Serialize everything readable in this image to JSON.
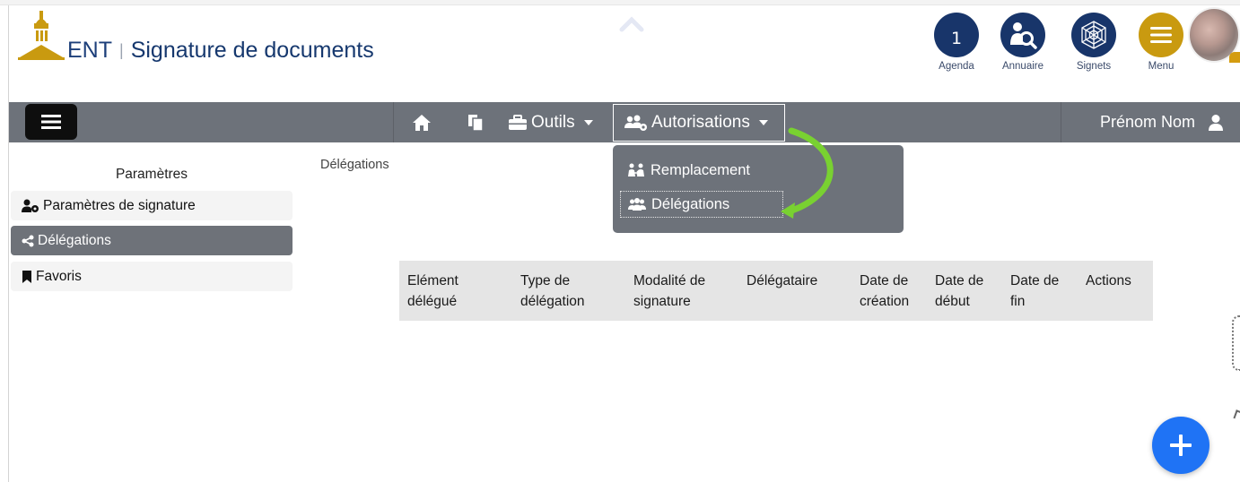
{
  "header": {
    "brand": "ENT",
    "separator": "|",
    "app_title": "Signature de documents",
    "shortcuts": [
      {
        "label": "Agenda",
        "icon": "calendar-icon",
        "value": "1"
      },
      {
        "label": "Annuaire",
        "icon": "directory-search-icon"
      },
      {
        "label": "Signets",
        "icon": "spiderweb-icon"
      },
      {
        "label": "Menu",
        "icon": "menu-icon"
      }
    ],
    "colors": {
      "brand_blue": "#18356a",
      "brand_gold": "#c99a10"
    }
  },
  "navbar": {
    "outils_label": "Outils",
    "autorisations_label": "Autorisations",
    "user_label": "Prénom Nom",
    "background": "#6d727a"
  },
  "dropdown": {
    "items": [
      {
        "label": "Remplacement",
        "icon": "replacement-icon"
      },
      {
        "label": "Délégations",
        "icon": "users-icon"
      }
    ]
  },
  "sidebar": {
    "title": "Paramètres",
    "items": [
      {
        "label": "Paramètres de signature",
        "icon": "user-gear-icon",
        "active": false
      },
      {
        "label": "Délégations",
        "icon": "share-icon",
        "active": true
      },
      {
        "label": "Favoris",
        "icon": "bookmark-icon",
        "active": false
      }
    ]
  },
  "main": {
    "breadcrumb": "Délégations",
    "table": {
      "columns": [
        {
          "line1": "Elément",
          "line2": "délégué"
        },
        {
          "line1": "Type de",
          "line2": "délégation"
        },
        {
          "line1": "Modalité de",
          "line2": "signature"
        },
        {
          "line1": "",
          "line2": "Délégataire"
        },
        {
          "line1": "Date de",
          "line2": "création"
        },
        {
          "line1": "Date de",
          "line2": "début"
        },
        {
          "line1": "Date de",
          "line2": "fin"
        },
        {
          "line1": "",
          "line2": "Actions"
        }
      ],
      "rows": []
    }
  },
  "fab": {
    "icon": "plus-icon",
    "color": "#1f73f5"
  }
}
